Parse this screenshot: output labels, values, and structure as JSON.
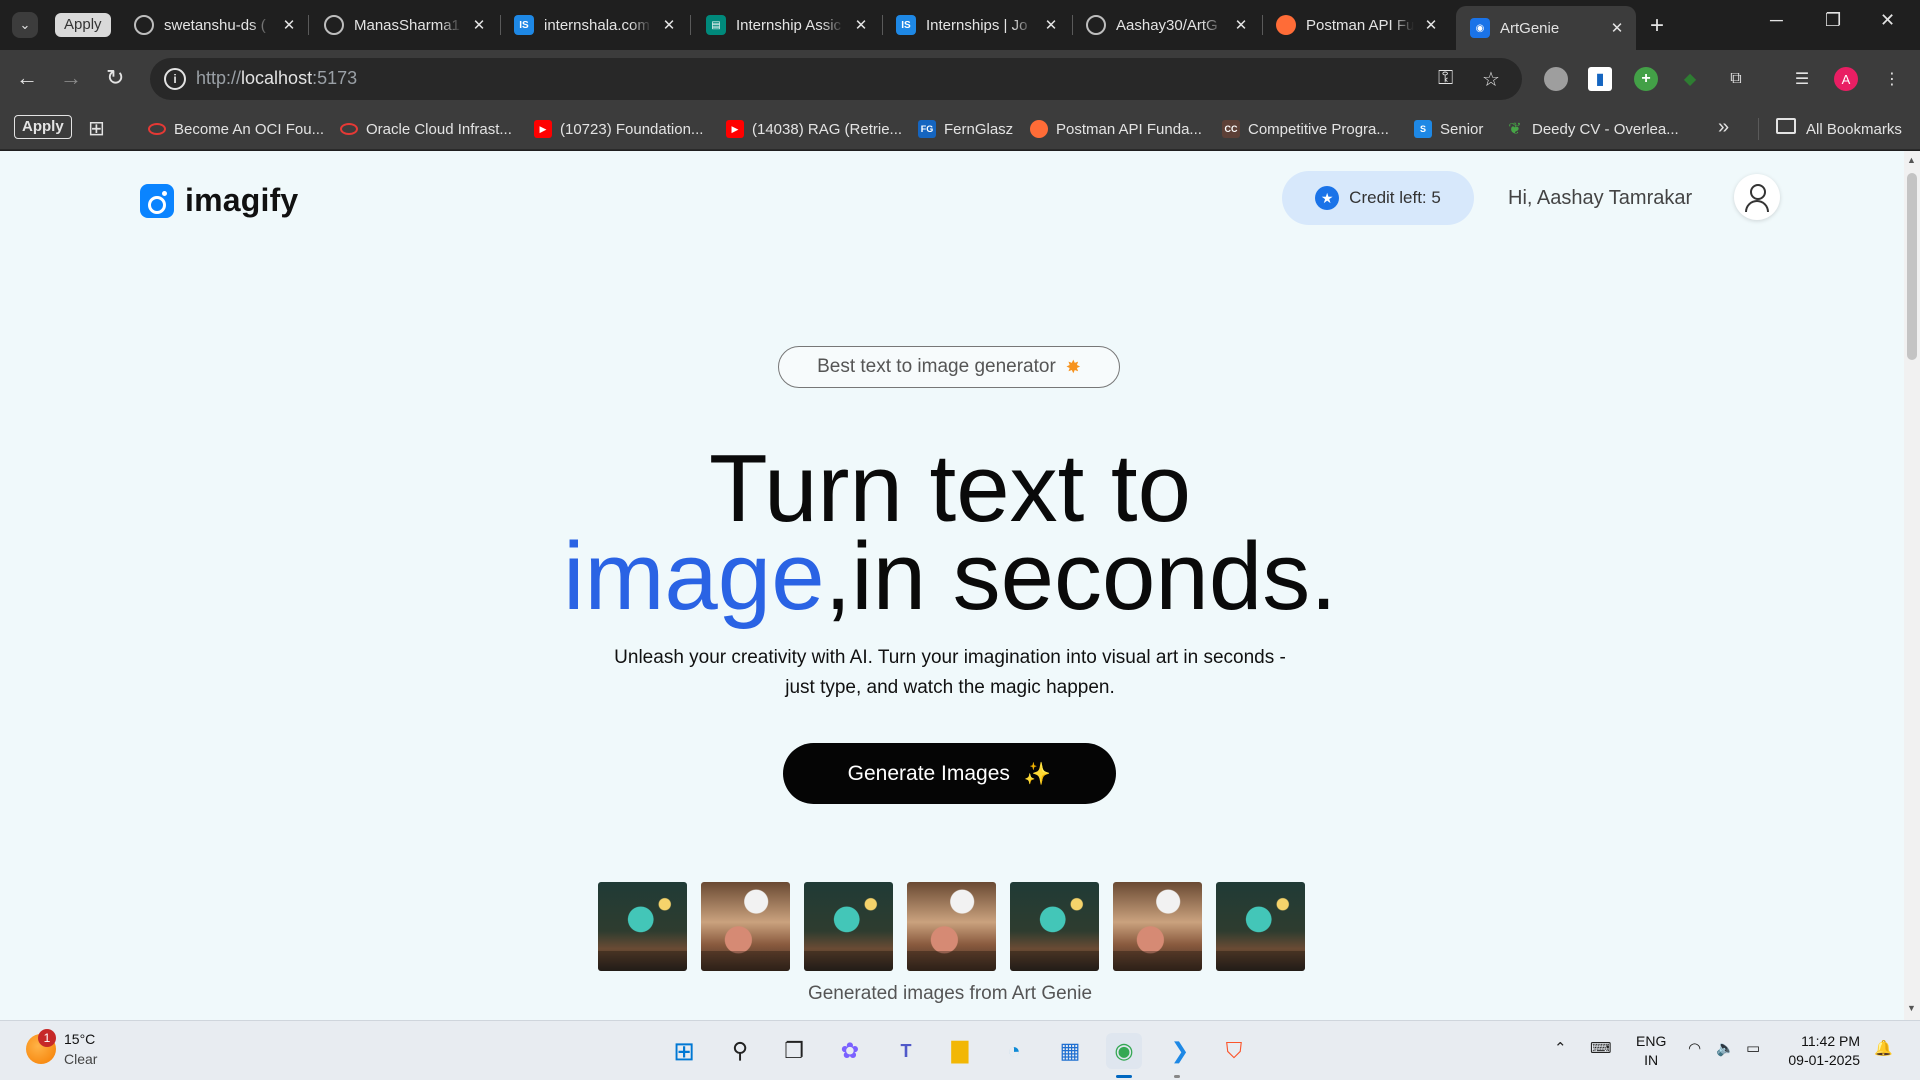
{
  "browser": {
    "tab_search_label": "⌄",
    "tab_chip": "Apply",
    "tabs": [
      {
        "label": "swetanshu-ds (",
        "icon": "github-icon"
      },
      {
        "label": "ManasSharma1",
        "icon": "github-icon"
      },
      {
        "label": "internshala.com",
        "icon": "internshala-icon"
      },
      {
        "label": "Internship Assic",
        "icon": "internshala-icon"
      },
      {
        "label": "Internships | Jo",
        "icon": "internshala-icon"
      },
      {
        "label": "Aashay30/ArtG",
        "icon": "github-icon"
      },
      {
        "label": "Postman API Fu",
        "icon": "postman-icon"
      },
      {
        "label": "ArtGenie",
        "icon": "artgenie-icon"
      }
    ],
    "url_scheme": "http://",
    "url_host": "localhost",
    "url_port": ":5173",
    "bookmarks_apply": "Apply",
    "bookmarks": [
      "Become An OCI Fou...",
      "Oracle Cloud Infrast...",
      "(10723) Foundation...",
      "(14038) RAG (Retrie...",
      "FernGlasz",
      "Postman API Funda...",
      "Competitive Progra...",
      "Senior",
      "Deedy CV - Overlea..."
    ],
    "all_bookmarks": "All Bookmarks",
    "profile_initial": "A"
  },
  "page": {
    "logo_text": "imagify",
    "credit_label": "Credit left: 5",
    "greeting": "Hi, Aashay Tamrakar",
    "badge_text": "Best text to image generator",
    "headline_line1": "Turn text to",
    "headline_blue": "image",
    "headline_rest": ",in seconds.",
    "subtext_line1": "Unleash your creativity with AI. Turn your imagination into visual art in seconds -",
    "subtext_line2": "just type, and watch the magic happen.",
    "cta_label": "Generate Images",
    "caption": "Generated images from Art Genie"
  },
  "taskbar": {
    "weather_alerts": "1",
    "temperature": "15°C",
    "condition": "Clear",
    "lang_line1": "ENG",
    "lang_line2": "IN",
    "time": "11:42 PM",
    "date": "09-01-2025"
  },
  "colors": {
    "page_background": "#f0f9fb",
    "accent_blue": "#2a63e4",
    "cta_background": "#050505",
    "credit_pill": "#d7e8fb"
  }
}
